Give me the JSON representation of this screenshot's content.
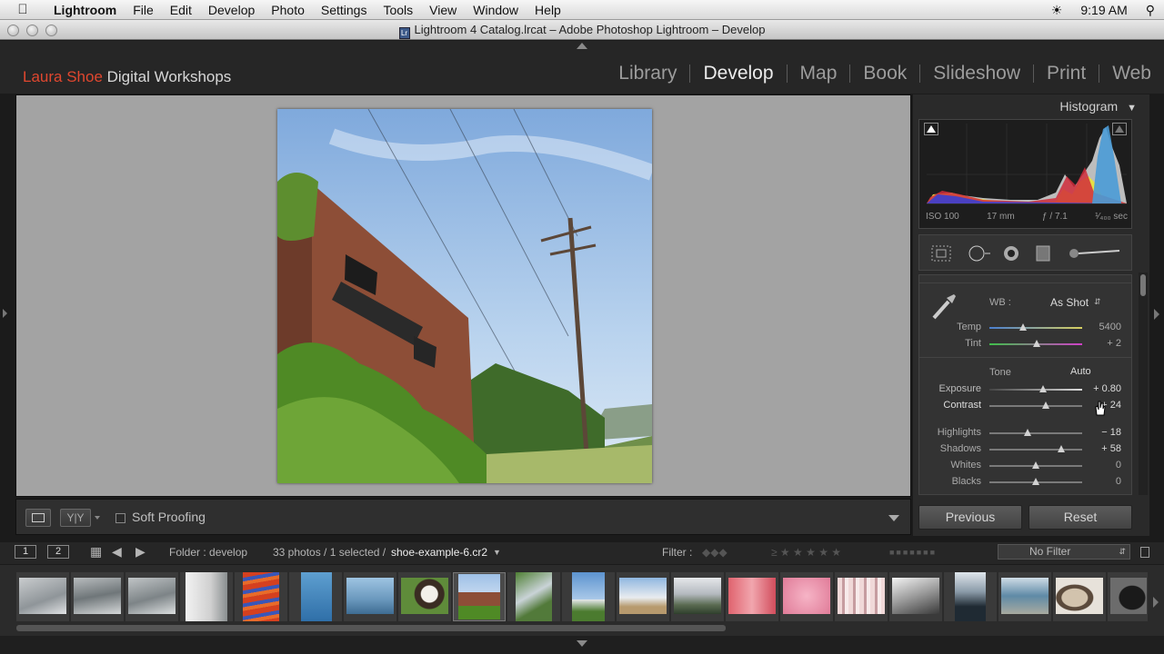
{
  "menubar": {
    "apple_icon": "apple-icon",
    "app": "Lightroom",
    "items": [
      "File",
      "Edit",
      "Develop",
      "Photo",
      "Settings",
      "Tools",
      "View",
      "Window",
      "Help"
    ],
    "time": "9:19 AM"
  },
  "window": {
    "title": "Lightroom 4 Catalog.lrcat – Adobe Photoshop Lightroom – Develop"
  },
  "top": {
    "brand_red": "Laura Shoe",
    "brand_rest": " Digital Workshops",
    "modules": [
      "Library",
      "Develop",
      "Map",
      "Book",
      "Slideshow",
      "Print",
      "Web"
    ],
    "active_module": "Develop"
  },
  "toolbar": {
    "soft_proofing": "Soft Proofing"
  },
  "histogram": {
    "title": "Histogram",
    "iso": "ISO 100",
    "focal": "17 mm",
    "aperture": "ƒ / 7.1",
    "shutter": "¹⁄₄₀₀ sec"
  },
  "basic": {
    "wb_label": "WB :",
    "wb_value": "As Shot",
    "tone_label": "Tone",
    "auto_label": "Auto",
    "sliders": [
      {
        "label": "Temp",
        "value": "5400",
        "level": 0.36
      },
      {
        "label": "Tint",
        "value": "+ 2",
        "level": 0.51
      },
      {
        "label": "Exposure",
        "value": "+ 0.80",
        "level": 0.58
      },
      {
        "label": "Contrast",
        "value": "+ 24",
        "level": 0.61
      },
      {
        "label": "Highlights",
        "value": "− 18",
        "level": 0.41
      },
      {
        "label": "Shadows",
        "value": "+ 58",
        "level": 0.77
      },
      {
        "label": "Whites",
        "value": "0",
        "level": 0.5
      },
      {
        "label": "Blacks",
        "value": "0",
        "level": 0.5
      }
    ]
  },
  "buttons": {
    "previous": "Previous",
    "reset": "Reset"
  },
  "filmstrip": {
    "monitor1": "1",
    "monitor2": "2",
    "folder": "Folder : develop",
    "count": "33 photos / 1 selected /",
    "filename": "shoe-example-6.cr2",
    "filter_label": "Filter :",
    "filter_value": "No Filter"
  },
  "colors": {
    "accent_red": "#e0472f",
    "panel_bg": "#2a2a2a",
    "preview_bg": "#a3a3a3"
  }
}
